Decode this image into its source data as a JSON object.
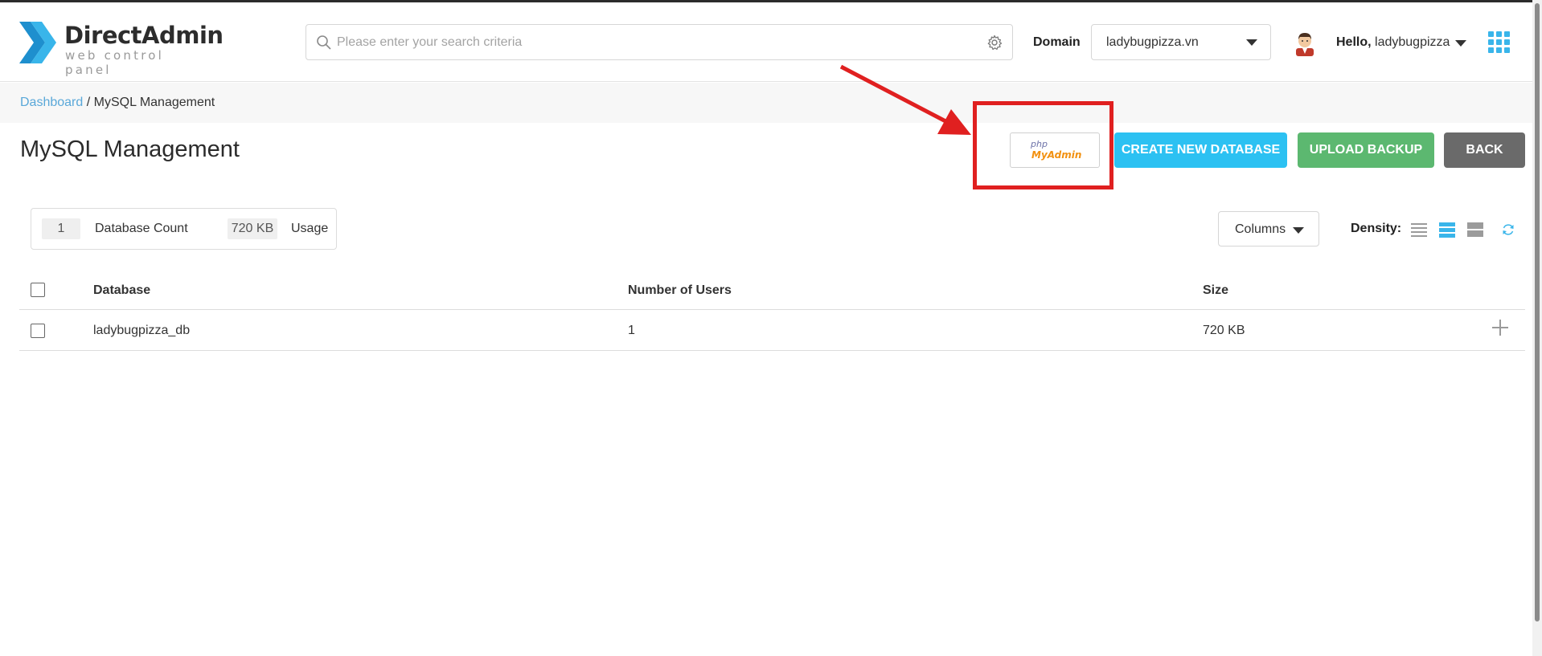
{
  "header": {
    "logo_title": "DirectAdmin",
    "logo_subtitle": "web control panel",
    "search_placeholder": "Please enter your search criteria",
    "domain_label": "Domain",
    "domain_value": "ladybugpizza.vn",
    "hello_prefix": "Hello,",
    "username": "ladybugpizza",
    "icons": [
      "search-icon",
      "gear-icon",
      "chevron-down-icon",
      "avatar",
      "apps-grid-icon"
    ]
  },
  "breadcrumb": {
    "root": "Dashboard",
    "separator": " / ",
    "current": "MySQL Management"
  },
  "page": {
    "title": "MySQL Management"
  },
  "actions": {
    "phpmyadmin_php": "php",
    "phpmyadmin_myadmin": "MyAdmin",
    "create_label": "CREATE NEW DATABASE",
    "upload_label": "UPLOAD BACKUP",
    "back_label": "BACK"
  },
  "stats": {
    "database_count": "1",
    "database_count_label": "Database Count",
    "usage": "720 KB",
    "usage_label": "Usage"
  },
  "toolbar": {
    "columns_label": "Columns",
    "density_label": "Density:",
    "density_selected": "normal"
  },
  "table": {
    "headers": [
      "Database",
      "Number of Users",
      "Size"
    ],
    "rows": [
      {
        "database": "ladybugpizza_db",
        "users": "1",
        "size": "720 KB"
      }
    ]
  },
  "colors": {
    "accent_blue": "#2cc1f2",
    "upload_green": "#5cb870",
    "back_gray": "#6a6a6a",
    "link_blue": "#5aa8d9",
    "annotation_red": "#e02020",
    "apps_icon_blue": "#39b5ea"
  }
}
